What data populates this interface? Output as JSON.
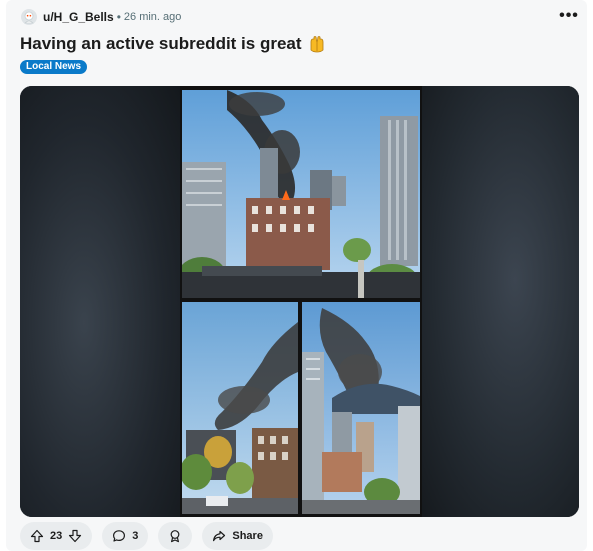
{
  "post": {
    "username": "u/H_G_Bells",
    "separator": "•",
    "time": "26 min. ago",
    "title": "Having an active subreddit is great",
    "flair": "Local News",
    "overflow_glyph": "•••"
  },
  "actions": {
    "upvotes": "23",
    "comments": "3",
    "share_label": "Share"
  },
  "colors": {
    "flair_bg": "#0a7ac9",
    "card_bg": "#f6f7f8",
    "pill_bg": "#e9ecee"
  },
  "icons": {
    "emoji": "hands-raised-emoji-icon",
    "upvote": "upvote-arrow-icon",
    "downvote": "downvote-arrow-icon",
    "comment": "comment-bubble-icon",
    "award": "award-icon",
    "share": "share-arrow-icon"
  }
}
